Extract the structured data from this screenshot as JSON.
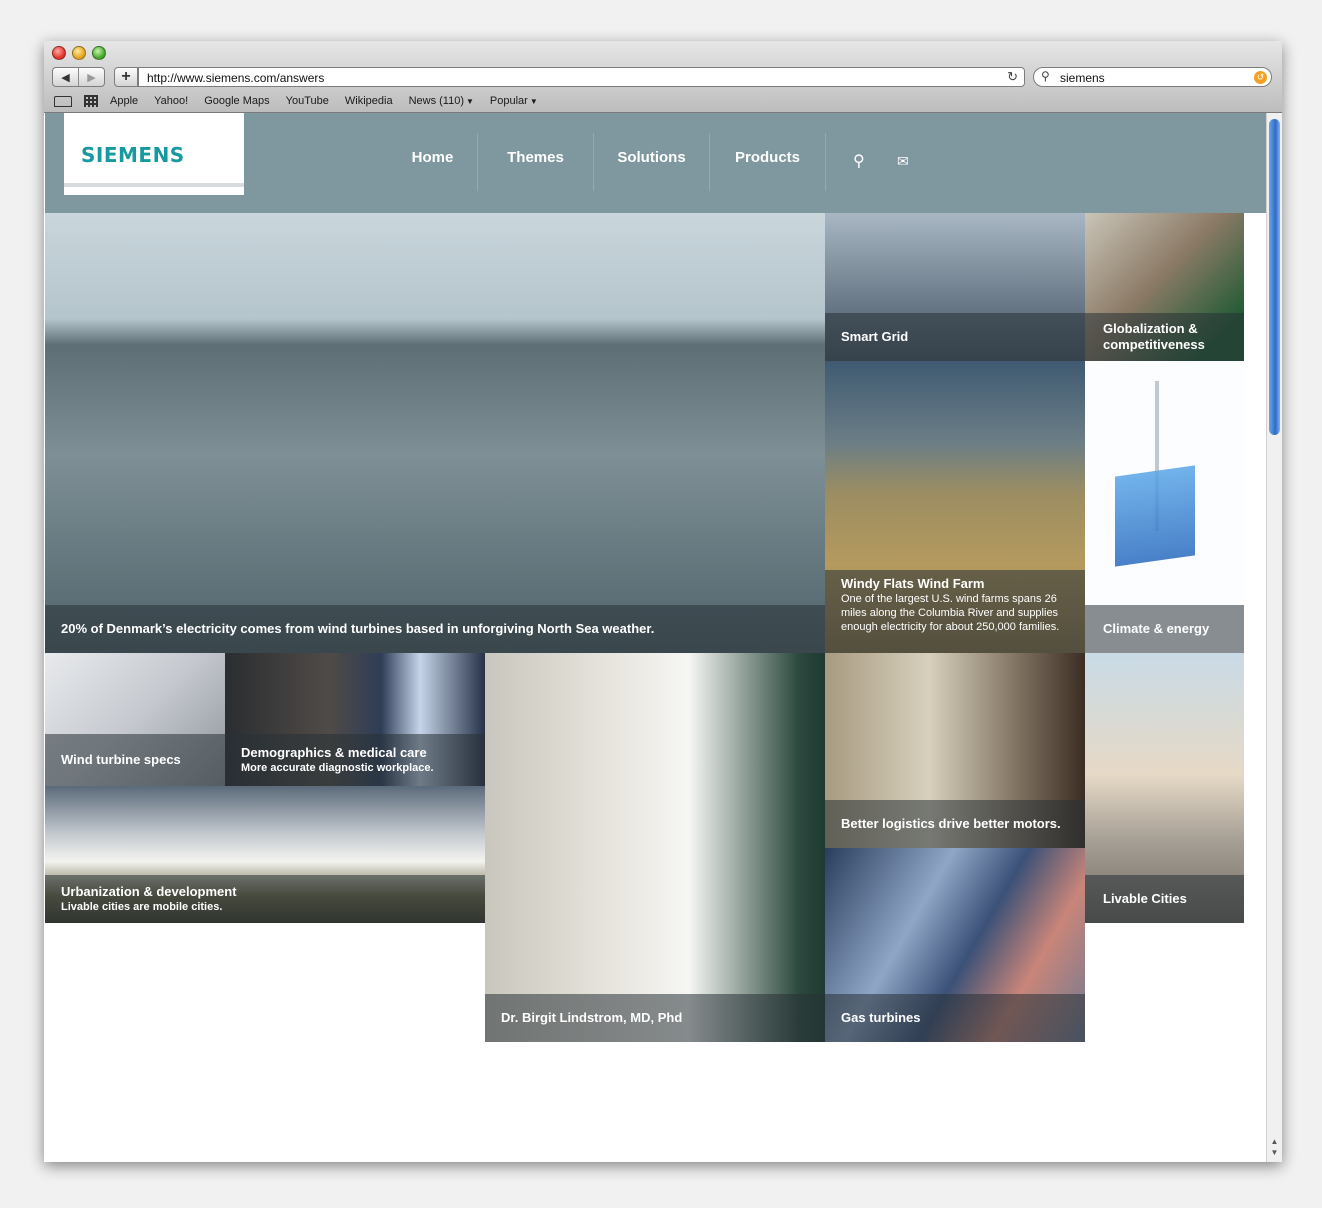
{
  "browser": {
    "url": "http://www.siemens.com/answers",
    "search_value": "siemens",
    "bookmarks": [
      "Apple",
      "Yahoo!",
      "Google Maps",
      "YouTube",
      "Wikipedia",
      "News (110)",
      "Popular"
    ]
  },
  "site": {
    "logo": "SIEMENS",
    "nav": [
      "Home",
      "Themes",
      "Solutions",
      "Products"
    ]
  },
  "tiles": {
    "main": "20% of Denmark’s electricity comes from wind turbines based in unforgiving North Sea weather.",
    "smart_grid": "Smart Grid",
    "globalization": "Globalization & competitiveness",
    "windy_title": "Windy Flats Wind Farm",
    "windy_sub": "One of the largest U.S. wind farms spans 26 miles along the Columbia River and supplies enough electricity for about 250,000 families.",
    "climate": "Climate & energy",
    "wind_specs": "Wind turbine specs",
    "demo_title": "Demographics & medical care",
    "demo_sub": "More accurate diagnostic workplace.",
    "urban_title": "Urbanization & development",
    "urban_sub": "Livable cities are mobile cities.",
    "doctor": "Dr. Birgit Lindstrom, MD, Phd",
    "logistics": "Better logistics drive better motors.",
    "livable": "Livable Cities",
    "gas": "Gas turbines"
  }
}
